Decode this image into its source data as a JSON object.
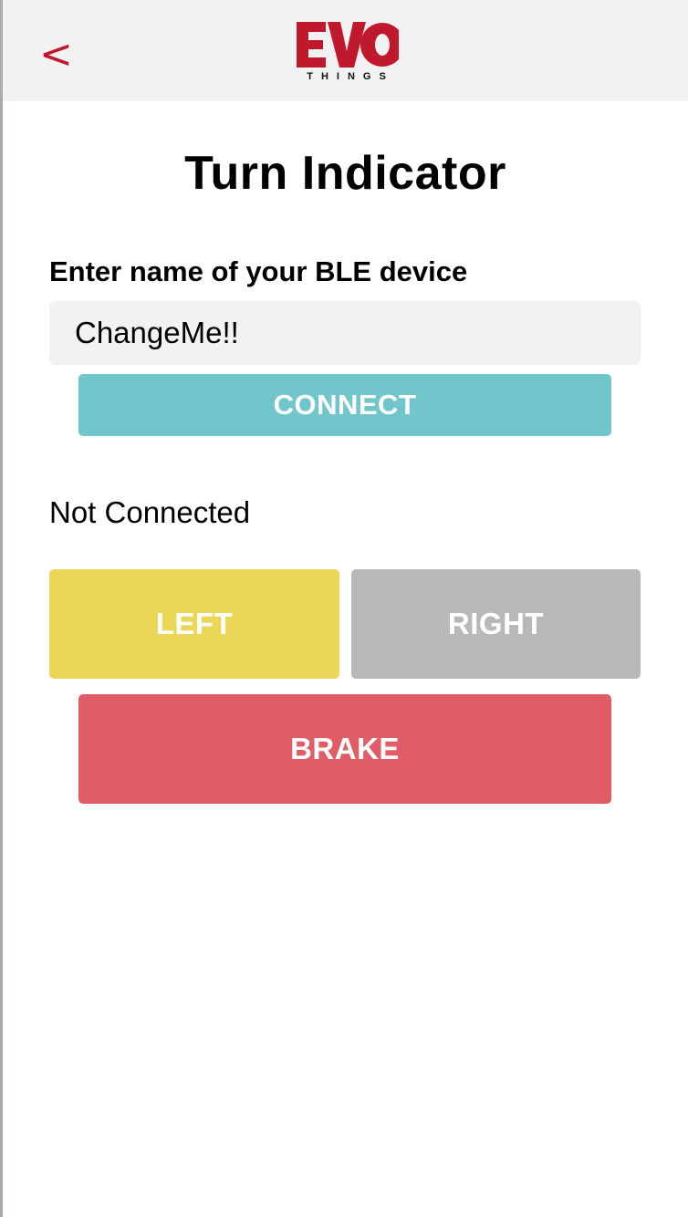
{
  "header": {
    "back_label": "<",
    "logo_main": "EVO",
    "logo_sub": "THINGS",
    "colors": {
      "brand_red": "#c0182c",
      "bar_bg": "#f2f2f2"
    }
  },
  "page": {
    "title": "Turn Indicator",
    "field_label": "Enter name of your BLE device",
    "device_name_value": "ChangeMe!!",
    "connect_label": "CONNECT",
    "status_text": "Not Connected",
    "left_label": "LEFT",
    "right_label": "RIGHT",
    "brake_label": "BRAKE"
  },
  "colors": {
    "connect": "#71c6cc",
    "left": "#ecd657",
    "right": "#b8b8b8",
    "brake": "#e05c66"
  },
  "icons": {
    "back": "chevron-left-icon",
    "logo": "evothings-logo"
  }
}
